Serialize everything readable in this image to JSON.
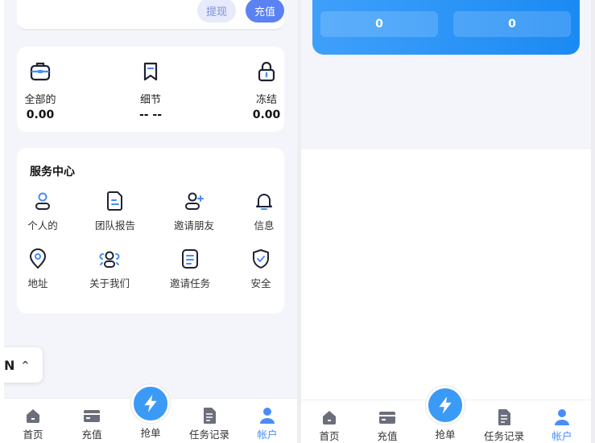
{
  "left": {
    "top_buttons": {
      "withdraw": "提现",
      "recharge": "充值"
    },
    "balances": [
      {
        "icon": "briefcase-icon",
        "label": "全部的",
        "value": "0.00"
      },
      {
        "icon": "bookmark-icon",
        "label": "细节",
        "value": "-- --"
      },
      {
        "icon": "lock-icon",
        "label": "冻结",
        "value": "0.00"
      }
    ],
    "service": {
      "title": "服务中心",
      "items": [
        {
          "icon": "person-icon",
          "label": "个人的"
        },
        {
          "icon": "document-icon",
          "label": "团队报告"
        },
        {
          "icon": "add-friend-icon",
          "label": "邀请朋友"
        },
        {
          "icon": "bell-icon",
          "label": "信息"
        },
        {
          "icon": "location-pin-icon",
          "label": "地址"
        },
        {
          "icon": "team-icon",
          "label": "关于我们"
        },
        {
          "icon": "task-list-icon",
          "label": "邀请任务"
        },
        {
          "icon": "shield-icon",
          "label": "安全"
        }
      ]
    },
    "language": {
      "code": "N",
      "chevron": "^"
    }
  },
  "right": {
    "stats": [
      "0",
      "0"
    ]
  },
  "tabbar": [
    {
      "icon": "home-icon",
      "label": "首页"
    },
    {
      "icon": "card-icon",
      "label": "充值"
    },
    {
      "icon": "lightning-icon",
      "label": "抢单"
    },
    {
      "icon": "file-icon",
      "label": "任务记录"
    },
    {
      "icon": "user-icon",
      "label": "帐户",
      "active": true
    }
  ],
  "colors": {
    "accent": "#4a8cf7",
    "brand_blue": "#2a93f6",
    "icon_gray": "#6b6f7b",
    "bg": "#f4f5fa"
  }
}
